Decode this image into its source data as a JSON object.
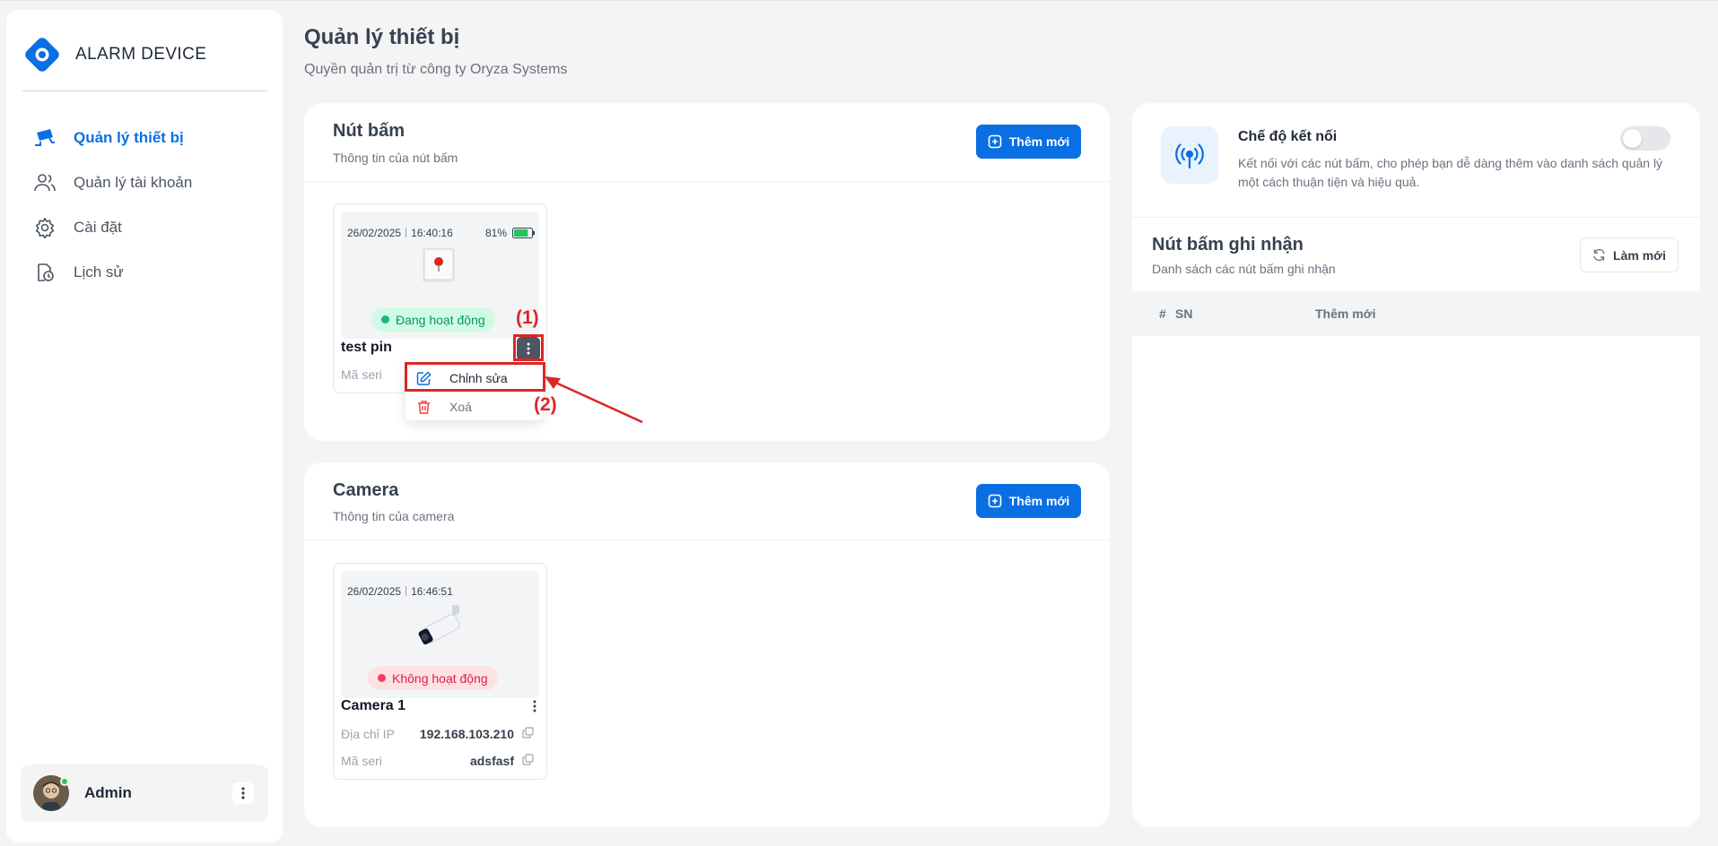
{
  "brand": {
    "name": "ALARM DEVICE",
    "color": "#0a6fe3"
  },
  "nav": {
    "items": [
      {
        "label": "Quản lý thiết bị",
        "icon": "cctv-camera-icon",
        "active": true
      },
      {
        "label": "Quản lý tài khoản",
        "icon": "users-icon",
        "active": false
      },
      {
        "label": "Cài đặt",
        "icon": "gear-icon",
        "active": false
      },
      {
        "label": "Lịch sử",
        "icon": "history-clock-icon",
        "active": false
      }
    ]
  },
  "user": {
    "name": "Admin",
    "status": "online"
  },
  "page": {
    "title": "Quản lý thiết bị",
    "subtitle": "Quyền quản trị từ công ty Oryza Systems"
  },
  "buttons_panel": {
    "title": "Nút bấm",
    "subtitle": "Thông tin của nút bấm",
    "add_label": "Thêm mới",
    "card": {
      "date": "26/02/2025",
      "time": "16:40:16",
      "battery": "81%",
      "battery_level": 0.81,
      "status": "Đang hoạt động",
      "status_color": "#10b981",
      "name": "test pin",
      "serial_label": "Mã seri"
    },
    "menu": {
      "edit_label": "Chỉnh sửa",
      "delete_label": "Xoá"
    }
  },
  "camera_panel": {
    "title": "Camera",
    "subtitle": "Thông tin của camera",
    "add_label": "Thêm mới",
    "card": {
      "date": "26/02/2025",
      "time": "16:46:51",
      "status": "Không hoạt động",
      "status_color": "#f43f5e",
      "name": "Camera 1",
      "ip_label": "Địa chỉ IP",
      "ip_value": "192.168.103.210",
      "serial_label": "Mã seri",
      "serial_value": "adsfasf"
    }
  },
  "connection": {
    "title": "Chế độ kết nối",
    "description": "Kết nối với các nút bấm, cho phép bạn dễ dàng thêm vào danh sách quản lý một cách thuận tiện và hiệu quả.",
    "enabled": false
  },
  "recorded": {
    "title": "Nút bấm ghi nhận",
    "subtitle": "Danh sách các nút bấm ghi nhận",
    "refresh_label": "Làm mới",
    "columns": [
      "#",
      "SN",
      "Thêm mới"
    ],
    "rows": []
  },
  "annotations": {
    "label_1": "(1)",
    "label_2": "(2)",
    "color": "#dc2626"
  }
}
